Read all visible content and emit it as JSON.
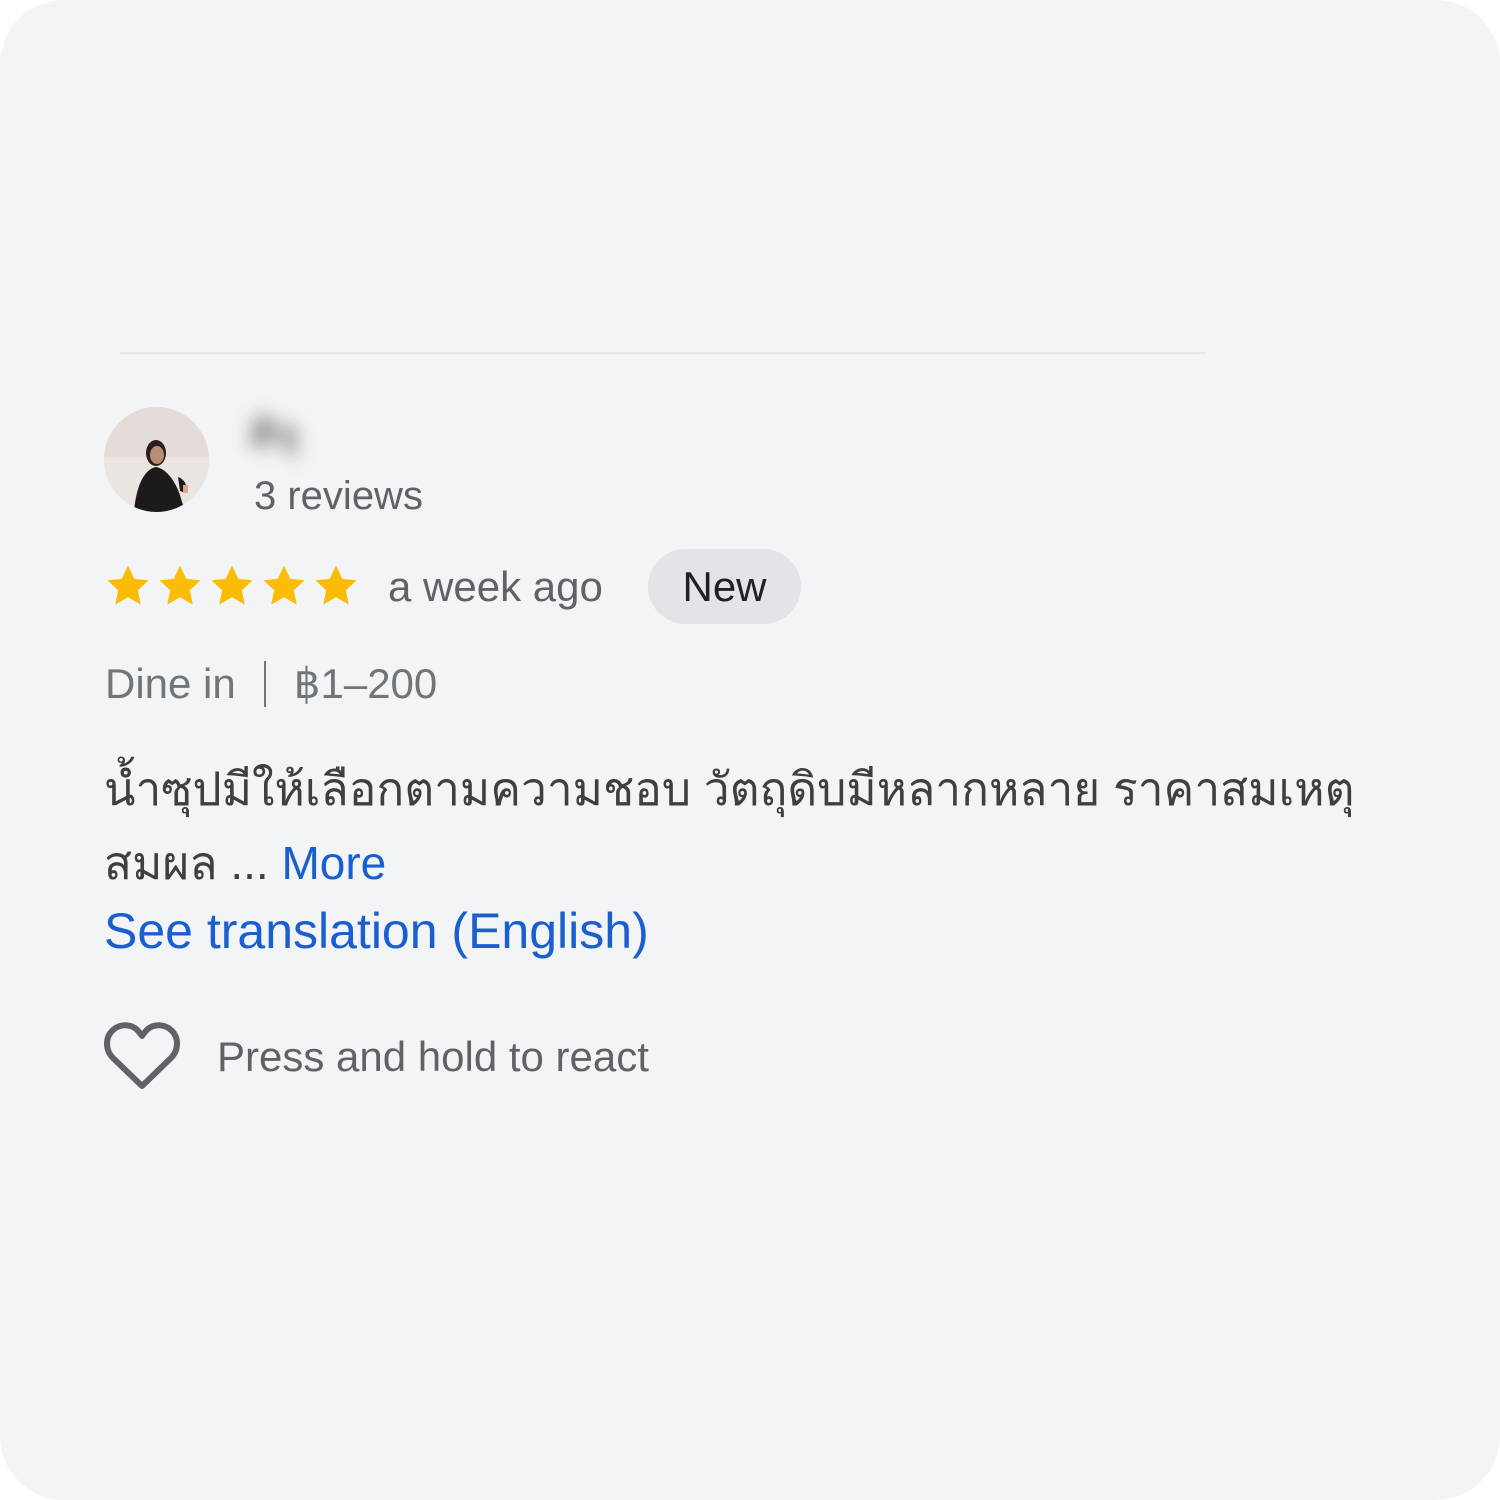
{
  "review": {
    "reviewer_name": "ศิจุ",
    "review_count": "3 reviews",
    "rating": 5,
    "rating_max": 5,
    "time": "a week ago",
    "badge": "New",
    "service": "Dine in",
    "price_range": "฿1–200",
    "text": "น้ำซุปมีให้เลือกตามความชอบ วัตถุดิบมีหลากหลาย ราคาสมเหตุสมผล ... ",
    "more_label": "More",
    "translation_label": "See translation (English)"
  },
  "react": {
    "label": "Press and hold to react",
    "icon": "heart-outline-icon"
  },
  "colors": {
    "card_background": "#f3f4f6",
    "star": "#fbbc04",
    "link": "#1a5fd0",
    "badge_background": "#e3e4e7"
  }
}
